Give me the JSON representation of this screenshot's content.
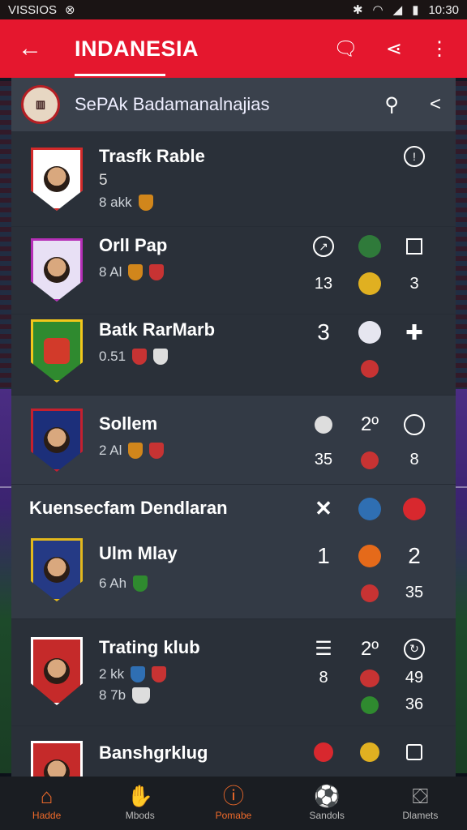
{
  "status": {
    "left_text": "VISSIOS",
    "time": "10:30"
  },
  "appbar": {
    "title": "INDANESIA"
  },
  "search": {
    "text": "SePAk Badamanalnajias"
  },
  "rows_top": [
    {
      "name": "Trasfk Rable",
      "line2": "5",
      "sub": "8 akk",
      "crest_bg": "#ffffff",
      "crest_border": "#d32a2a"
    },
    {
      "name": "Orll Pap",
      "sub": "8 Al",
      "crest_bg": "#e8e0f5",
      "crest_border": "#b52fb7",
      "s1": "13",
      "s3": "3"
    },
    {
      "name": "Batk RarMarb",
      "sub": "0.51",
      "crest_bg": "#2f8a2f",
      "crest_border": "#f2c71b",
      "big": "3"
    }
  ],
  "rows_mid": [
    {
      "name": "Sollem",
      "sub": "2 Al",
      "crest_bg": "#1c2f7a",
      "crest_border": "#c5202e",
      "t2": "2º",
      "s1": "35",
      "s3": "8"
    }
  ],
  "section": {
    "title": "Kuensecfam Dendlaran"
  },
  "rows_bottom": [
    {
      "name": "Ulm Mlay",
      "sub": "6 Ah",
      "crest_bg": "#253a85",
      "crest_border": "#e3b81c",
      "big1": "1",
      "big2": "2",
      "s3": "35"
    },
    {
      "name": "Trating klub",
      "sub": "2 kk",
      "sub2": "8 7b",
      "crest_bg": "#c52a2a",
      "crest_border": "#ffffff",
      "t2": "2º",
      "s1": "8",
      "s2": "49",
      "s3": "36"
    },
    {
      "name": "Banshgrklug",
      "crest_bg": "#c52a2a",
      "crest_border": "#ffffff"
    }
  ],
  "nav": [
    {
      "label": "Hadde",
      "icon": "home-icon"
    },
    {
      "label": "Mbods",
      "icon": "hand-icon"
    },
    {
      "label": "Pomabe",
      "icon": "info-icon"
    },
    {
      "label": "Sandols",
      "icon": "ball-icon"
    },
    {
      "label": "Dlamets",
      "icon": "bag-icon"
    }
  ],
  "colors": {
    "brand": "#e5172e",
    "accent": "#ef6a2a",
    "panel": "#2d343e"
  }
}
